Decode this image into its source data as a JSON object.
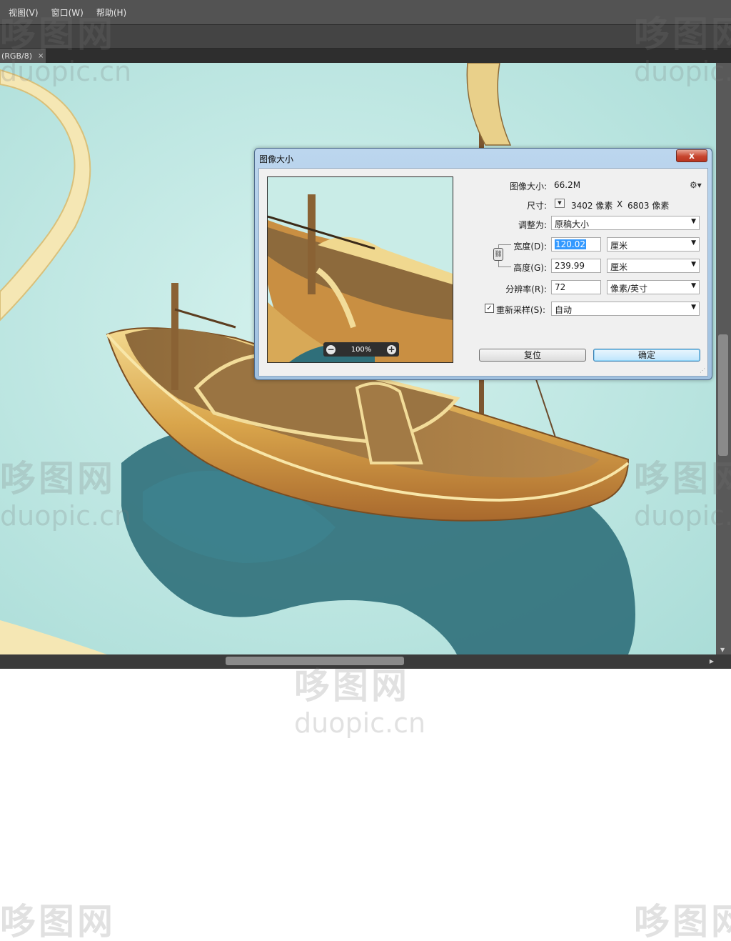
{
  "menu": {
    "items": [
      {
        "label": "视图(V)"
      },
      {
        "label": "窗口(W)"
      },
      {
        "label": "帮助(H)"
      }
    ]
  },
  "document_tab": {
    "label": "(RGB/8)",
    "close_glyph": "×"
  },
  "dialog": {
    "title": "图像大小",
    "close_glyph": "x",
    "image_size_label": "图像大小:",
    "image_size_value": "66.2M",
    "dimensions_label": "尺寸:",
    "dimensions_width": "3402 像素",
    "dimensions_sep": "X",
    "dimensions_height": "6803 像素",
    "fit_to_label": "调整为:",
    "fit_to_value": "原稿大小",
    "width_label": "宽度(D):",
    "width_value": "120.02",
    "width_unit": "厘米",
    "height_label": "高度(G):",
    "height_value": "239.99",
    "height_unit": "厘米",
    "resolution_label": "分辨率(R):",
    "resolution_value": "72",
    "resolution_unit": "像素/英寸",
    "resample_label": "重新采样(S):",
    "resample_checked": true,
    "resample_value": "自动",
    "preview_zoom": "100%",
    "reset_label": "复位",
    "ok_label": "确定"
  },
  "watermark": {
    "logo_text": "哆图网",
    "url_text": "duopic.cn"
  },
  "icons": {
    "close": "close-icon",
    "gear": "gear-icon",
    "link": "chain-link-icon",
    "zoom_out": "zoom-out-icon",
    "zoom_in": "zoom-in-icon",
    "dropdown": "chevron-down-icon"
  },
  "colors": {
    "menubar": "#535353",
    "canvas_bg": "#c6ebe6",
    "dialog_frame": "#a9c6e3",
    "selection": "#3399ff",
    "close_button": "#c7452e"
  }
}
